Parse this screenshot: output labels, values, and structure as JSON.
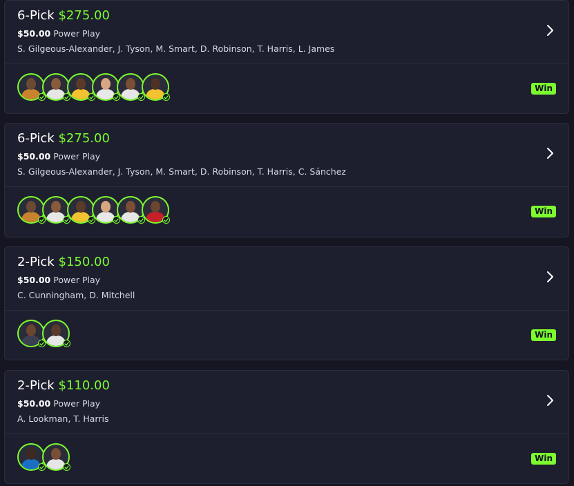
{
  "accent_color": "#7cfc2e",
  "entries": [
    {
      "pick_label": "6-Pick",
      "payout": "$275.00",
      "wager": "$50.00",
      "play_type": "Power Play",
      "players": "S. Gilgeous-Alexander, J. Tyson, M. Smart, D. Robinson, T. Harris, L. James",
      "result": "Win",
      "avatars": [
        {
          "skin": "#6b4a33",
          "jersey": "#c9832e"
        },
        {
          "skin": "#8a5a3c",
          "jersey": "#e6e6e6"
        },
        {
          "skin": "#5a3a28",
          "jersey": "#f2c230"
        },
        {
          "skin": "#d9a682",
          "jersey": "#e8e8e8"
        },
        {
          "skin": "#7a4f36",
          "jersey": "#e6e6e6"
        },
        {
          "skin": "#4d3124",
          "jersey": "#f2c230"
        }
      ]
    },
    {
      "pick_label": "6-Pick",
      "payout": "$275.00",
      "wager": "$50.00",
      "play_type": "Power Play",
      "players": "S. Gilgeous-Alexander, J. Tyson, M. Smart, D. Robinson, T. Harris, C. Sánchez",
      "result": "Win",
      "avatars": [
        {
          "skin": "#6b4a33",
          "jersey": "#c9832e"
        },
        {
          "skin": "#8a5a3c",
          "jersey": "#e6e6e6"
        },
        {
          "skin": "#5a3a28",
          "jersey": "#f2c230"
        },
        {
          "skin": "#d9a682",
          "jersey": "#e8e8e8"
        },
        {
          "skin": "#7a4f36",
          "jersey": "#e6e6e6"
        },
        {
          "skin": "#6a452f",
          "jersey": "#c8202a"
        }
      ]
    },
    {
      "pick_label": "2-Pick",
      "payout": "$150.00",
      "wager": "$50.00",
      "play_type": "Power Play",
      "players": "C. Cunningham, D. Mitchell",
      "result": "Win",
      "avatars": [
        {
          "skin": "#6a4631",
          "jersey": "#3a3f52"
        },
        {
          "skin": "#5a3a28",
          "jersey": "#e6e6e6"
        }
      ]
    },
    {
      "pick_label": "2-Pick",
      "payout": "$110.00",
      "wager": "$50.00",
      "play_type": "Power Play",
      "players": "A. Lookman, T. Harris",
      "result": "Win",
      "avatars": [
        {
          "skin": "#3d2a20",
          "jersey": "#1a6fc4"
        },
        {
          "skin": "#7a4f36",
          "jersey": "#e6e6e6"
        }
      ]
    }
  ]
}
